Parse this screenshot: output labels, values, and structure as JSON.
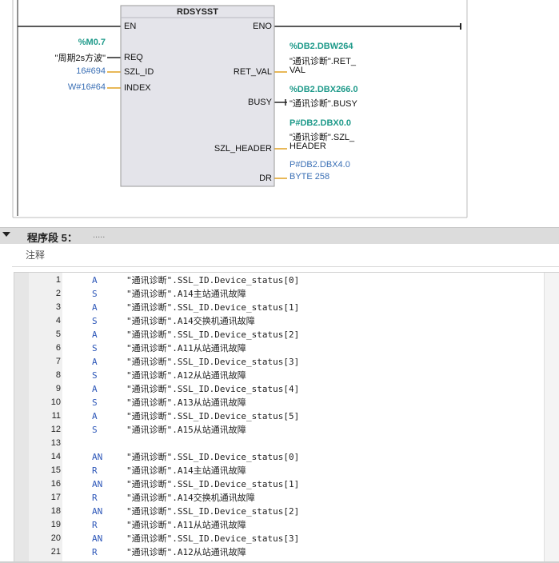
{
  "block": {
    "title": "RDSYSST",
    "pins_in": {
      "en": "EN",
      "req": "REQ",
      "szl_id": "SZL_ID",
      "index": "INDEX"
    },
    "pins_out": {
      "eno": "ENO",
      "ret_val": "RET_VAL",
      "busy": "BUSY",
      "szl_header": "SZL_HEADER",
      "dr": "DR"
    }
  },
  "operands": {
    "req_addr": "%M0.7",
    "req_name": "\"周期2s方波\"",
    "szl_id": "16#694",
    "index": "W#16#64",
    "ret_val_addr": "%DB2.DBW264",
    "ret_val_name1": "\"通讯诊断\".RET_",
    "ret_val_name2": "VAL",
    "busy_addr": "%DB2.DBX266.0",
    "busy_name": "\"通讯诊断\".BUSY",
    "header_addr": "P#DB2.DBX0.0",
    "header_name1": "\"通讯诊断\".SZL_",
    "header_name2": "HEADER",
    "dr_addr": "P#DB2.DBX4.0",
    "dr_name": "BYTE 258"
  },
  "network": {
    "title": "程序段 5：",
    "dots": ".....",
    "comment": "注释"
  },
  "colors": {
    "instruction": "#2c56b8",
    "operand_green": "#1e9a8a",
    "operand_blue": "#3a6fb5",
    "header_bg": "#dcdcdc"
  },
  "code": [
    {
      "n": "1",
      "ins": "A",
      "arg": "\"通讯诊断\".SSL_ID.Device_status[0]"
    },
    {
      "n": "2",
      "ins": "S",
      "arg": "\"通讯诊断\".A14主站通讯故障"
    },
    {
      "n": "3",
      "ins": "A",
      "arg": "\"通讯诊断\".SSL_ID.Device_status[1]"
    },
    {
      "n": "4",
      "ins": "S",
      "arg": "\"通讯诊断\".A14交换机通讯故障"
    },
    {
      "n": "5",
      "ins": "A",
      "arg": "\"通讯诊断\".SSL_ID.Device_status[2]"
    },
    {
      "n": "6",
      "ins": "S",
      "arg": "\"通讯诊断\".A11从站通讯故障"
    },
    {
      "n": "7",
      "ins": "A",
      "arg": "\"通讯诊断\".SSL_ID.Device_status[3]"
    },
    {
      "n": "8",
      "ins": "S",
      "arg": "\"通讯诊断\".A12从站通讯故障"
    },
    {
      "n": "9",
      "ins": "A",
      "arg": "\"通讯诊断\".SSL_ID.Device_status[4]"
    },
    {
      "n": "10",
      "ins": "S",
      "arg": "\"通讯诊断\".A13从站通讯故障"
    },
    {
      "n": "11",
      "ins": "A",
      "arg": "\"通讯诊断\".SSL_ID.Device_status[5]"
    },
    {
      "n": "12",
      "ins": "S",
      "arg": "\"通讯诊断\".A15从站通讯故障"
    },
    {
      "n": "13",
      "ins": "",
      "arg": ""
    },
    {
      "n": "14",
      "ins": "AN",
      "arg": "\"通讯诊断\".SSL_ID.Device_status[0]"
    },
    {
      "n": "15",
      "ins": "R",
      "arg": "\"通讯诊断\".A14主站通讯故障"
    },
    {
      "n": "16",
      "ins": "AN",
      "arg": "\"通讯诊断\".SSL_ID.Device_status[1]"
    },
    {
      "n": "17",
      "ins": "R",
      "arg": "\"通讯诊断\".A14交换机通讯故障"
    },
    {
      "n": "18",
      "ins": "AN",
      "arg": "\"通讯诊断\".SSL_ID.Device_status[2]"
    },
    {
      "n": "19",
      "ins": "R",
      "arg": "\"通讯诊断\".A11从站通讯故障"
    },
    {
      "n": "20",
      "ins": "AN",
      "arg": "\"通讯诊断\".SSL_ID.Device_status[3]"
    },
    {
      "n": "21",
      "ins": "R",
      "arg": "\"通讯诊断\".A12从站通讯故障"
    }
  ]
}
